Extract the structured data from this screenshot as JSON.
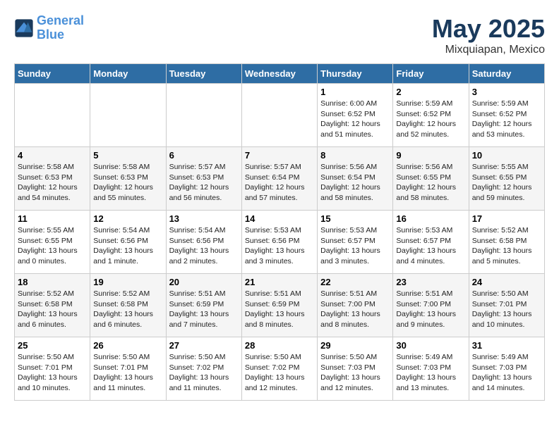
{
  "header": {
    "logo_line1": "General",
    "logo_line2": "Blue",
    "title": "May 2025",
    "subtitle": "Mixquiapan, Mexico"
  },
  "days_of_week": [
    "Sunday",
    "Monday",
    "Tuesday",
    "Wednesday",
    "Thursday",
    "Friday",
    "Saturday"
  ],
  "weeks": [
    [
      {
        "day": "",
        "info": ""
      },
      {
        "day": "",
        "info": ""
      },
      {
        "day": "",
        "info": ""
      },
      {
        "day": "",
        "info": ""
      },
      {
        "day": "1",
        "info": "Sunrise: 6:00 AM\nSunset: 6:52 PM\nDaylight: 12 hours\nand 51 minutes."
      },
      {
        "day": "2",
        "info": "Sunrise: 5:59 AM\nSunset: 6:52 PM\nDaylight: 12 hours\nand 52 minutes."
      },
      {
        "day": "3",
        "info": "Sunrise: 5:59 AM\nSunset: 6:52 PM\nDaylight: 12 hours\nand 53 minutes."
      }
    ],
    [
      {
        "day": "4",
        "info": "Sunrise: 5:58 AM\nSunset: 6:53 PM\nDaylight: 12 hours\nand 54 minutes."
      },
      {
        "day": "5",
        "info": "Sunrise: 5:58 AM\nSunset: 6:53 PM\nDaylight: 12 hours\nand 55 minutes."
      },
      {
        "day": "6",
        "info": "Sunrise: 5:57 AM\nSunset: 6:53 PM\nDaylight: 12 hours\nand 56 minutes."
      },
      {
        "day": "7",
        "info": "Sunrise: 5:57 AM\nSunset: 6:54 PM\nDaylight: 12 hours\nand 57 minutes."
      },
      {
        "day": "8",
        "info": "Sunrise: 5:56 AM\nSunset: 6:54 PM\nDaylight: 12 hours\nand 58 minutes."
      },
      {
        "day": "9",
        "info": "Sunrise: 5:56 AM\nSunset: 6:55 PM\nDaylight: 12 hours\nand 58 minutes."
      },
      {
        "day": "10",
        "info": "Sunrise: 5:55 AM\nSunset: 6:55 PM\nDaylight: 12 hours\nand 59 minutes."
      }
    ],
    [
      {
        "day": "11",
        "info": "Sunrise: 5:55 AM\nSunset: 6:55 PM\nDaylight: 13 hours\nand 0 minutes."
      },
      {
        "day": "12",
        "info": "Sunrise: 5:54 AM\nSunset: 6:56 PM\nDaylight: 13 hours\nand 1 minute."
      },
      {
        "day": "13",
        "info": "Sunrise: 5:54 AM\nSunset: 6:56 PM\nDaylight: 13 hours\nand 2 minutes."
      },
      {
        "day": "14",
        "info": "Sunrise: 5:53 AM\nSunset: 6:56 PM\nDaylight: 13 hours\nand 3 minutes."
      },
      {
        "day": "15",
        "info": "Sunrise: 5:53 AM\nSunset: 6:57 PM\nDaylight: 13 hours\nand 3 minutes."
      },
      {
        "day": "16",
        "info": "Sunrise: 5:53 AM\nSunset: 6:57 PM\nDaylight: 13 hours\nand 4 minutes."
      },
      {
        "day": "17",
        "info": "Sunrise: 5:52 AM\nSunset: 6:58 PM\nDaylight: 13 hours\nand 5 minutes."
      }
    ],
    [
      {
        "day": "18",
        "info": "Sunrise: 5:52 AM\nSunset: 6:58 PM\nDaylight: 13 hours\nand 6 minutes."
      },
      {
        "day": "19",
        "info": "Sunrise: 5:52 AM\nSunset: 6:58 PM\nDaylight: 13 hours\nand 6 minutes."
      },
      {
        "day": "20",
        "info": "Sunrise: 5:51 AM\nSunset: 6:59 PM\nDaylight: 13 hours\nand 7 minutes."
      },
      {
        "day": "21",
        "info": "Sunrise: 5:51 AM\nSunset: 6:59 PM\nDaylight: 13 hours\nand 8 minutes."
      },
      {
        "day": "22",
        "info": "Sunrise: 5:51 AM\nSunset: 7:00 PM\nDaylight: 13 hours\nand 8 minutes."
      },
      {
        "day": "23",
        "info": "Sunrise: 5:51 AM\nSunset: 7:00 PM\nDaylight: 13 hours\nand 9 minutes."
      },
      {
        "day": "24",
        "info": "Sunrise: 5:50 AM\nSunset: 7:01 PM\nDaylight: 13 hours\nand 10 minutes."
      }
    ],
    [
      {
        "day": "25",
        "info": "Sunrise: 5:50 AM\nSunset: 7:01 PM\nDaylight: 13 hours\nand 10 minutes."
      },
      {
        "day": "26",
        "info": "Sunrise: 5:50 AM\nSunset: 7:01 PM\nDaylight: 13 hours\nand 11 minutes."
      },
      {
        "day": "27",
        "info": "Sunrise: 5:50 AM\nSunset: 7:02 PM\nDaylight: 13 hours\nand 11 minutes."
      },
      {
        "day": "28",
        "info": "Sunrise: 5:50 AM\nSunset: 7:02 PM\nDaylight: 13 hours\nand 12 minutes."
      },
      {
        "day": "29",
        "info": "Sunrise: 5:50 AM\nSunset: 7:03 PM\nDaylight: 13 hours\nand 12 minutes."
      },
      {
        "day": "30",
        "info": "Sunrise: 5:49 AM\nSunset: 7:03 PM\nDaylight: 13 hours\nand 13 minutes."
      },
      {
        "day": "31",
        "info": "Sunrise: 5:49 AM\nSunset: 7:03 PM\nDaylight: 13 hours\nand 14 minutes."
      }
    ]
  ]
}
